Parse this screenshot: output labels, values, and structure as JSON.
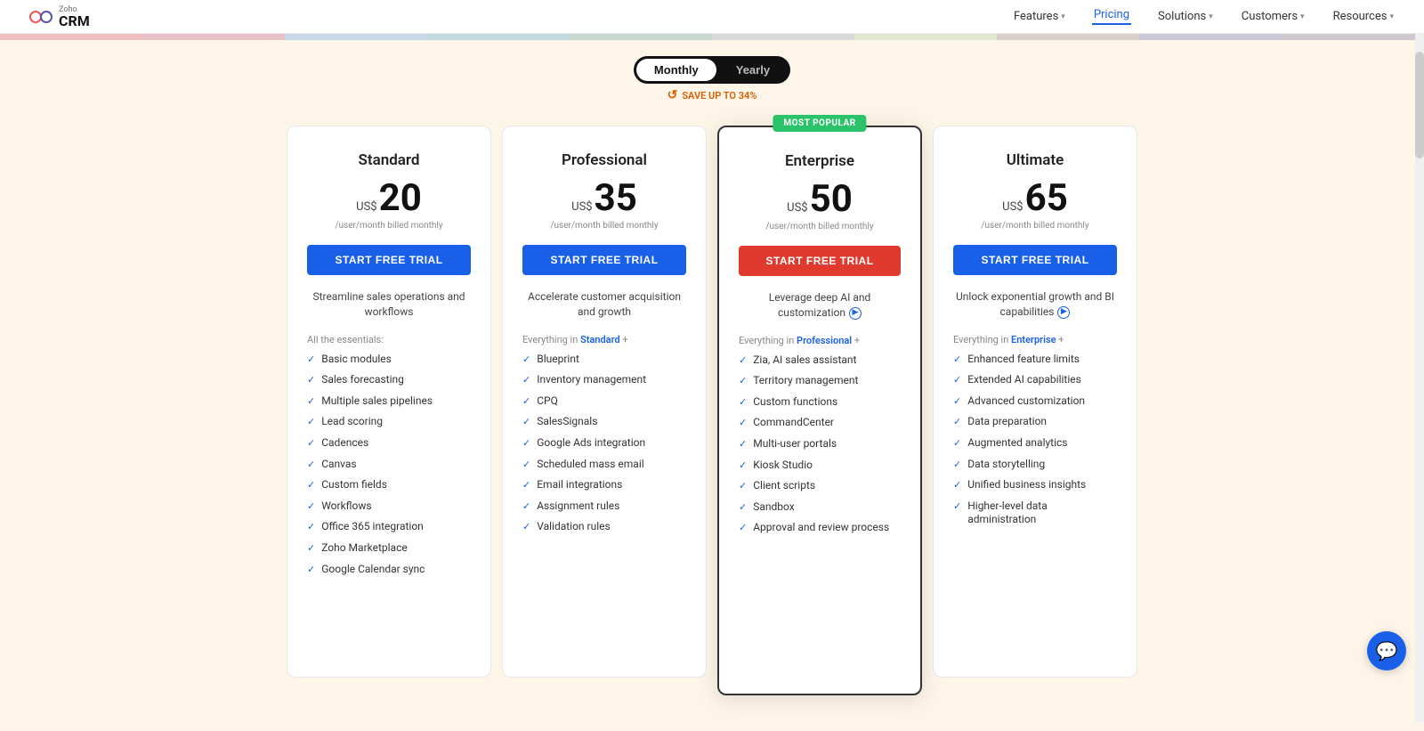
{
  "logo": {
    "brand": "Zoho",
    "product": "CRM"
  },
  "nav": {
    "links": [
      {
        "label": "Features",
        "hasDropdown": true,
        "active": false
      },
      {
        "label": "Pricing",
        "hasDropdown": false,
        "active": true
      },
      {
        "label": "Solutions",
        "hasDropdown": true,
        "active": false
      },
      {
        "label": "Customers",
        "hasDropdown": true,
        "active": false
      },
      {
        "label": "Resources",
        "hasDropdown": true,
        "active": false
      }
    ]
  },
  "billing": {
    "monthly_label": "Monthly",
    "yearly_label": "Yearly",
    "save_text": "SAVE UP TO 34%",
    "active": "monthly"
  },
  "plans": [
    {
      "id": "standard",
      "name": "Standard",
      "currency": "US$",
      "price": "20",
      "period": "/user/month billed monthly",
      "cta": "START FREE TRIAL",
      "cta_color": "blue",
      "description": "Streamline sales operations and workflows",
      "features_label": "All the essentials:",
      "features_prefix": null,
      "highlighted": false,
      "most_popular": false,
      "features": [
        "Basic modules",
        "Sales forecasting",
        "Multiple sales pipelines",
        "Lead scoring",
        "Cadences",
        "Canvas",
        "Custom fields",
        "Workflows",
        "Office 365 integration",
        "Zoho Marketplace",
        "Google Calendar sync"
      ]
    },
    {
      "id": "professional",
      "name": "Professional",
      "currency": "US$",
      "price": "35",
      "period": "/user/month billed monthly",
      "cta": "START FREE TRIAL",
      "cta_color": "blue",
      "description": "Accelerate customer acquisition and growth",
      "features_label": "Everything in Standard +",
      "features_prefix": "Standard",
      "highlighted": false,
      "most_popular": false,
      "features": [
        "Blueprint",
        "Inventory management",
        "CPQ",
        "SalesSignals",
        "Google Ads integration",
        "Scheduled mass email",
        "Email integrations",
        "Assignment rules",
        "Validation rules"
      ]
    },
    {
      "id": "enterprise",
      "name": "Enterprise",
      "currency": "US$",
      "price": "50",
      "period": "/user/month billed monthly",
      "cta": "START FREE TRIAL",
      "cta_color": "red",
      "description": "Leverage deep AI and customization",
      "features_label": "Everything in Professional +",
      "features_prefix": "Professional",
      "highlighted": true,
      "most_popular": true,
      "most_popular_text": "MOST POPULAR",
      "features": [
        "Zia, AI sales assistant",
        "Territory management",
        "Custom functions",
        "CommandCenter",
        "Multi-user portals",
        "Kiosk Studio",
        "Client scripts",
        "Sandbox",
        "Approval and review process"
      ]
    },
    {
      "id": "ultimate",
      "name": "Ultimate",
      "currency": "US$",
      "price": "65",
      "period": "/user/month billed monthly",
      "cta": "START FREE TRIAL",
      "cta_color": "blue",
      "description": "Unlock exponential growth and BI capabilities",
      "features_label": "Everything in Enterprise +",
      "features_prefix": "Enterprise",
      "highlighted": false,
      "most_popular": false,
      "features": [
        "Enhanced feature limits",
        "Extended AI capabilities",
        "Advanced customization",
        "Data preparation",
        "Augmented analytics",
        "Data storytelling",
        "Unified business insights",
        "Higher-level data administration"
      ]
    }
  ],
  "color_band": [
    "#f0c0c0",
    "#e8c0c8",
    "#c8d8e8",
    "#c0d8e0",
    "#c8d8d0",
    "#d8d8d8",
    "#e0e8d0",
    "#d8d0c8",
    "#c8c8d8",
    "#d0c8d0"
  ],
  "chat": {
    "icon": "💬"
  }
}
